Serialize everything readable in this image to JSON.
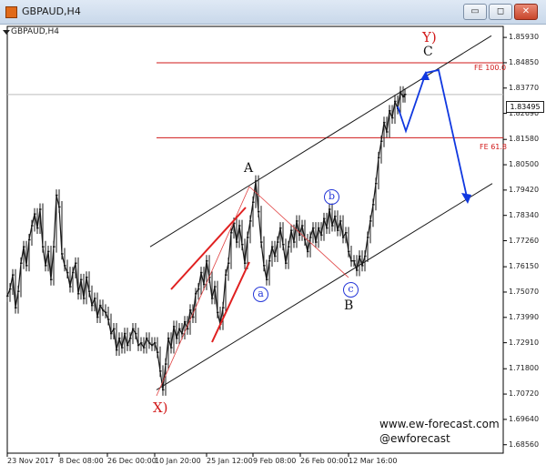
{
  "window": {
    "title": "GBPAUD,H4",
    "buttons": {
      "minimize": "▭",
      "restore": "◻",
      "close": "✕"
    }
  },
  "chart_label": "GBPAUD,H4",
  "chart_data": {
    "type": "line",
    "symbol": "GBPAUD",
    "timeframe": "H4",
    "price_ticks": [
      "1.85930",
      "1.84850",
      "1.83770",
      "1.82690",
      "1.81580",
      "1.80500",
      "1.79420",
      "1.78340",
      "1.77260",
      "1.76150",
      "1.75070",
      "1.73990",
      "1.72910",
      "1.71800",
      "1.70720",
      "1.69640",
      "1.68560"
    ],
    "time_ticks": [
      "23 Nov 2017",
      "8 Dec 08:00",
      "26 Dec 00:00",
      "10 Jan 20:00",
      "25 Jan 12:00",
      "9 Feb 08:00",
      "26 Feb 00:00",
      "12 Mar 16:00"
    ],
    "current_price": "1.83495",
    "series_points": [
      [
        0,
        1.749
      ],
      [
        3,
        1.752
      ],
      [
        6,
        1.758
      ],
      [
        9,
        1.744
      ],
      [
        12,
        1.751
      ],
      [
        15,
        1.763
      ],
      [
        18,
        1.77
      ],
      [
        21,
        1.762
      ],
      [
        24,
        1.773
      ],
      [
        27,
        1.779
      ],
      [
        30,
        1.784
      ],
      [
        33,
        1.778
      ],
      [
        36,
        1.786
      ],
      [
        39,
        1.77
      ],
      [
        42,
        1.762
      ],
      [
        45,
        1.768
      ],
      [
        48,
        1.756
      ],
      [
        51,
        1.77
      ],
      [
        54,
        1.792
      ],
      [
        57,
        1.787
      ],
      [
        60,
        1.767
      ],
      [
        63,
        1.762
      ],
      [
        66,
        1.759
      ],
      [
        69,
        1.753
      ],
      [
        72,
        1.759
      ],
      [
        75,
        1.763
      ],
      [
        78,
        1.75
      ],
      [
        81,
        1.756
      ],
      [
        84,
        1.748
      ],
      [
        87,
        1.757
      ],
      [
        90,
        1.751
      ],
      [
        93,
        1.745
      ],
      [
        96,
        1.748
      ],
      [
        99,
        1.74
      ],
      [
        102,
        1.745
      ],
      [
        105,
        1.743
      ],
      [
        108,
        1.742
      ],
      [
        111,
        1.739
      ],
      [
        114,
        1.733
      ],
      [
        117,
        1.735
      ],
      [
        120,
        1.726
      ],
      [
        123,
        1.731
      ],
      [
        126,
        1.727
      ],
      [
        129,
        1.733
      ],
      [
        132,
        1.728
      ],
      [
        135,
        1.731
      ],
      [
        138,
        1.735
      ],
      [
        141,
        1.733
      ],
      [
        144,
        1.728
      ],
      [
        147,
        1.729
      ],
      [
        150,
        1.727
      ],
      [
        153,
        1.731
      ],
      [
        156,
        1.729
      ],
      [
        159,
        1.728
      ],
      [
        162,
        1.729
      ],
      [
        165,
        1.725
      ],
      [
        168,
        1.717
      ],
      [
        171,
        1.709
      ],
      [
        174,
        1.72
      ],
      [
        177,
        1.731
      ],
      [
        180,
        1.727
      ],
      [
        183,
        1.736
      ],
      [
        186,
        1.731
      ],
      [
        189,
        1.735
      ],
      [
        192,
        1.733
      ],
      [
        195,
        1.738
      ],
      [
        198,
        1.735
      ],
      [
        201,
        1.743
      ],
      [
        204,
        1.74
      ],
      [
        207,
        1.75
      ],
      [
        210,
        1.752
      ],
      [
        213,
        1.759
      ],
      [
        216,
        1.754
      ],
      [
        219,
        1.764
      ],
      [
        222,
        1.757
      ],
      [
        225,
        1.748
      ],
      [
        228,
        1.753
      ],
      [
        231,
        1.742
      ],
      [
        234,
        1.737
      ],
      [
        237,
        1.744
      ],
      [
        240,
        1.758
      ],
      [
        243,
        1.763
      ],
      [
        246,
        1.776
      ],
      [
        249,
        1.78
      ],
      [
        252,
        1.772
      ],
      [
        255,
        1.779
      ],
      [
        258,
        1.771
      ],
      [
        261,
        1.763
      ],
      [
        264,
        1.774
      ],
      [
        267,
        1.781
      ],
      [
        270,
        1.789
      ],
      [
        273,
        1.798
      ],
      [
        276,
        1.785
      ],
      [
        279,
        1.772
      ],
      [
        282,
        1.762
      ],
      [
        285,
        1.756
      ],
      [
        288,
        1.764
      ],
      [
        291,
        1.77
      ],
      [
        294,
        1.766
      ],
      [
        297,
        1.772
      ],
      [
        300,
        1.778
      ],
      [
        303,
        1.771
      ],
      [
        306,
        1.763
      ],
      [
        309,
        1.77
      ],
      [
        312,
        1.777
      ],
      [
        315,
        1.772
      ],
      [
        318,
        1.781
      ],
      [
        321,
        1.775
      ],
      [
        324,
        1.779
      ],
      [
        327,
        1.773
      ],
      [
        330,
        1.768
      ],
      [
        333,
        1.774
      ],
      [
        336,
        1.778
      ],
      [
        339,
        1.772
      ],
      [
        342,
        1.778
      ],
      [
        345,
        1.775
      ],
      [
        348,
        1.782
      ],
      [
        351,
        1.778
      ],
      [
        354,
        1.786
      ],
      [
        357,
        1.779
      ],
      [
        360,
        1.783
      ],
      [
        363,
        1.777
      ],
      [
        366,
        1.781
      ],
      [
        369,
        1.774
      ],
      [
        372,
        1.776
      ],
      [
        375,
        1.768
      ],
      [
        378,
        1.764
      ],
      [
        381,
        1.764
      ],
      [
        384,
        1.76
      ],
      [
        387,
        1.766
      ],
      [
        390,
        1.762
      ],
      [
        393,
        1.766
      ],
      [
        396,
        1.774
      ],
      [
        399,
        1.781
      ],
      [
        402,
        1.788
      ],
      [
        405,
        1.797
      ],
      [
        408,
        1.808
      ],
      [
        411,
        1.815
      ],
      [
        414,
        1.823
      ],
      [
        417,
        1.819
      ],
      [
        420,
        1.828
      ],
      [
        423,
        1.825
      ],
      [
        426,
        1.832
      ],
      [
        429,
        1.829
      ],
      [
        432,
        1.836
      ],
      [
        435,
        1.834
      ],
      [
        437,
        1.835
      ]
    ],
    "channel": {
      "upper": [
        [
          165,
          1.77
        ],
        [
          540,
          1.86
        ]
      ],
      "lower": [
        [
          172,
          1.709
        ],
        [
          541,
          1.797
        ]
      ]
    },
    "fe_levels": [
      {
        "label": "FE 100.0",
        "price": 1.8485
      },
      {
        "label": "FE 61.8",
        "price": 1.8165
      }
    ],
    "current_line_price": 1.83495
  },
  "annotations": {
    "wave_x": "X)",
    "wave_a": "A",
    "wave_b": "B",
    "wave_c": "C",
    "wave_y": "Y)",
    "sub_a": "a",
    "sub_b": "b",
    "sub_c": "c",
    "fe_100": "FE 100.0",
    "fe_618": "FE 61.8"
  },
  "branding": {
    "site": "www.ew-forecast.com",
    "handle": "@ewforecast"
  },
  "colors": {
    "candles": "#1a1a1a",
    "channel": "#1a1a1a",
    "fe_line": "#d01818",
    "red_lines": "#e02020",
    "blue_path": "#1038e0",
    "grid_border": "#000000"
  }
}
